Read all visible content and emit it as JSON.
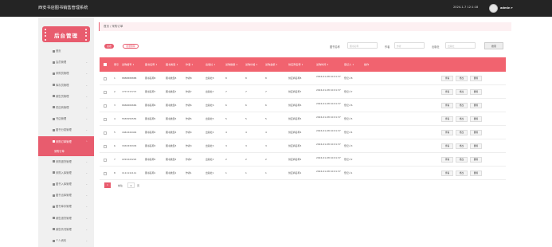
{
  "header": {
    "app_title": "西安书店图书销售管理系统",
    "datetime": "2024-1-7 12:1:18",
    "username": "admin ▾"
  },
  "sidebar": {
    "brand": "后台管理",
    "items": [
      {
        "label": "首页",
        "icon": "home-icon",
        "arrow": ""
      },
      {
        "label": "会员管理",
        "icon": "user-icon",
        "arrow": "⌄"
      },
      {
        "label": "采购员管理",
        "icon": "user-icon",
        "arrow": "⌄"
      },
      {
        "label": "库存员管理",
        "icon": "user-icon",
        "arrow": "⌄"
      },
      {
        "label": "销售员管理",
        "icon": "user-icon",
        "arrow": "⌄"
      },
      {
        "label": "供应商管理",
        "icon": "user-icon",
        "arrow": "⌄"
      },
      {
        "label": "书店管理",
        "icon": "grid-icon",
        "arrow": "⌄"
      },
      {
        "label": "图书分类管理",
        "icon": "grid-icon",
        "arrow": "⌄"
      },
      {
        "label": "采购订单管理",
        "icon": "grid-icon",
        "arrow": "⌃",
        "active": true
      },
      {
        "label": "采购退货管理",
        "icon": "grid-icon",
        "arrow": "⌄"
      },
      {
        "label": "采购入库管理",
        "icon": "grid-icon",
        "arrow": "⌄"
      },
      {
        "label": "图书入库管理",
        "icon": "grid-icon",
        "arrow": "⌄"
      },
      {
        "label": "图书出库管理",
        "icon": "grid-icon",
        "arrow": "⌄"
      },
      {
        "label": "图书库存管理",
        "icon": "grid-icon",
        "arrow": "⌄"
      },
      {
        "label": "销售退货管理",
        "icon": "grid-icon",
        "arrow": "⌄"
      },
      {
        "label": "销售情况管理",
        "icon": "grid-icon",
        "arrow": "⌄"
      },
      {
        "label": "个人资料",
        "icon": "user-icon",
        "arrow": "⌄"
      }
    ],
    "active_sub": "采购订单"
  },
  "breadcrumb": "首页 / 采购订单",
  "toolbar": {
    "add_label": "新增",
    "batch_delete_label": "批量删除"
  },
  "search": {
    "book_name_label": "图书名称",
    "book_name_placeholder": "图书名称",
    "author_label": "作者",
    "author_placeholder": "作者",
    "publisher_label": "出版社",
    "publisher_placeholder": "出版社",
    "search_label": "搜索"
  },
  "table": {
    "headers": [
      "索引",
      "采购编号",
      "图书名称",
      "图书类型",
      "作者",
      "出版社",
      "采购数量",
      "采购价格",
      "采购金额",
      "供应商名称",
      "采购时间",
      "登记人",
      "操作"
    ],
    "rows": [
      {
        "idx": "1",
        "no": "8888888888",
        "name": "图书名称8",
        "type": "图书类型8",
        "author": "作者8",
        "pub": "出版社8",
        "qty": "8",
        "price": "8",
        "amount": "8",
        "supplier": "供应商名称8",
        "time": "2024-01-08 10:01:37",
        "reg": "登记人8"
      },
      {
        "idx": "2",
        "no": "7777777777",
        "name": "图书名称7",
        "type": "图书类型7",
        "author": "作者7",
        "pub": "出版社7",
        "qty": "7",
        "price": "7",
        "amount": "7",
        "supplier": "供应商名称7",
        "time": "2024-01-08 10:01:37",
        "reg": "登记人7"
      },
      {
        "idx": "3",
        "no": "6666666666",
        "name": "图书名称6",
        "type": "图书类型6",
        "author": "作者6",
        "pub": "出版社6",
        "qty": "6",
        "price": "6",
        "amount": "6",
        "supplier": "供应商名称6",
        "time": "2024-01-08 10:01:37",
        "reg": "登记人6"
      },
      {
        "idx": "4",
        "no": "5555555555",
        "name": "图书名称5",
        "type": "图书类型5",
        "author": "作者5",
        "pub": "出版社5",
        "qty": "5",
        "price": "5",
        "amount": "5",
        "supplier": "供应商名称5",
        "time": "2024-01-08 10:01:37",
        "reg": "登记人5"
      },
      {
        "idx": "5",
        "no": "4444444444",
        "name": "图书名称4",
        "type": "图书类型4",
        "author": "作者4",
        "pub": "出版社4",
        "qty": "4",
        "price": "4",
        "amount": "4",
        "supplier": "供应商名称4",
        "time": "2024-01-08 10:01:37",
        "reg": "登记人4"
      },
      {
        "idx": "6",
        "no": "3333333333",
        "name": "图书名称3",
        "type": "图书类型3",
        "author": "作者3",
        "pub": "出版社3",
        "qty": "3",
        "price": "3",
        "amount": "3",
        "supplier": "供应商名称3",
        "time": "2024-01-08 10:01:37",
        "reg": "登记人3"
      },
      {
        "idx": "7",
        "no": "2222222222",
        "name": "图书名称2",
        "type": "图书类型2",
        "author": "作者2",
        "pub": "出版社2",
        "qty": "2",
        "price": "2",
        "amount": "2",
        "supplier": "供应商名称2",
        "time": "2024-01-08 10:01:37",
        "reg": "登记人2"
      },
      {
        "idx": "8",
        "no": "1111111111",
        "name": "图书名称1",
        "type": "图书类型1",
        "author": "作者1",
        "pub": "出版社1",
        "qty": "1",
        "price": "1",
        "amount": "1",
        "supplier": "供应商名称1",
        "time": "2024-01-08 10:01:37",
        "reg": "登记人1"
      }
    ],
    "actions": {
      "view": "查看",
      "edit": "修改",
      "delete": "删除"
    }
  },
  "pager": {
    "current": "1",
    "goto_label": "前往",
    "input_value": "1",
    "page_label": "页"
  },
  "colors": {
    "accent": "#e85c6e",
    "header_bg": "#f1636f",
    "topbar": "#242424"
  }
}
